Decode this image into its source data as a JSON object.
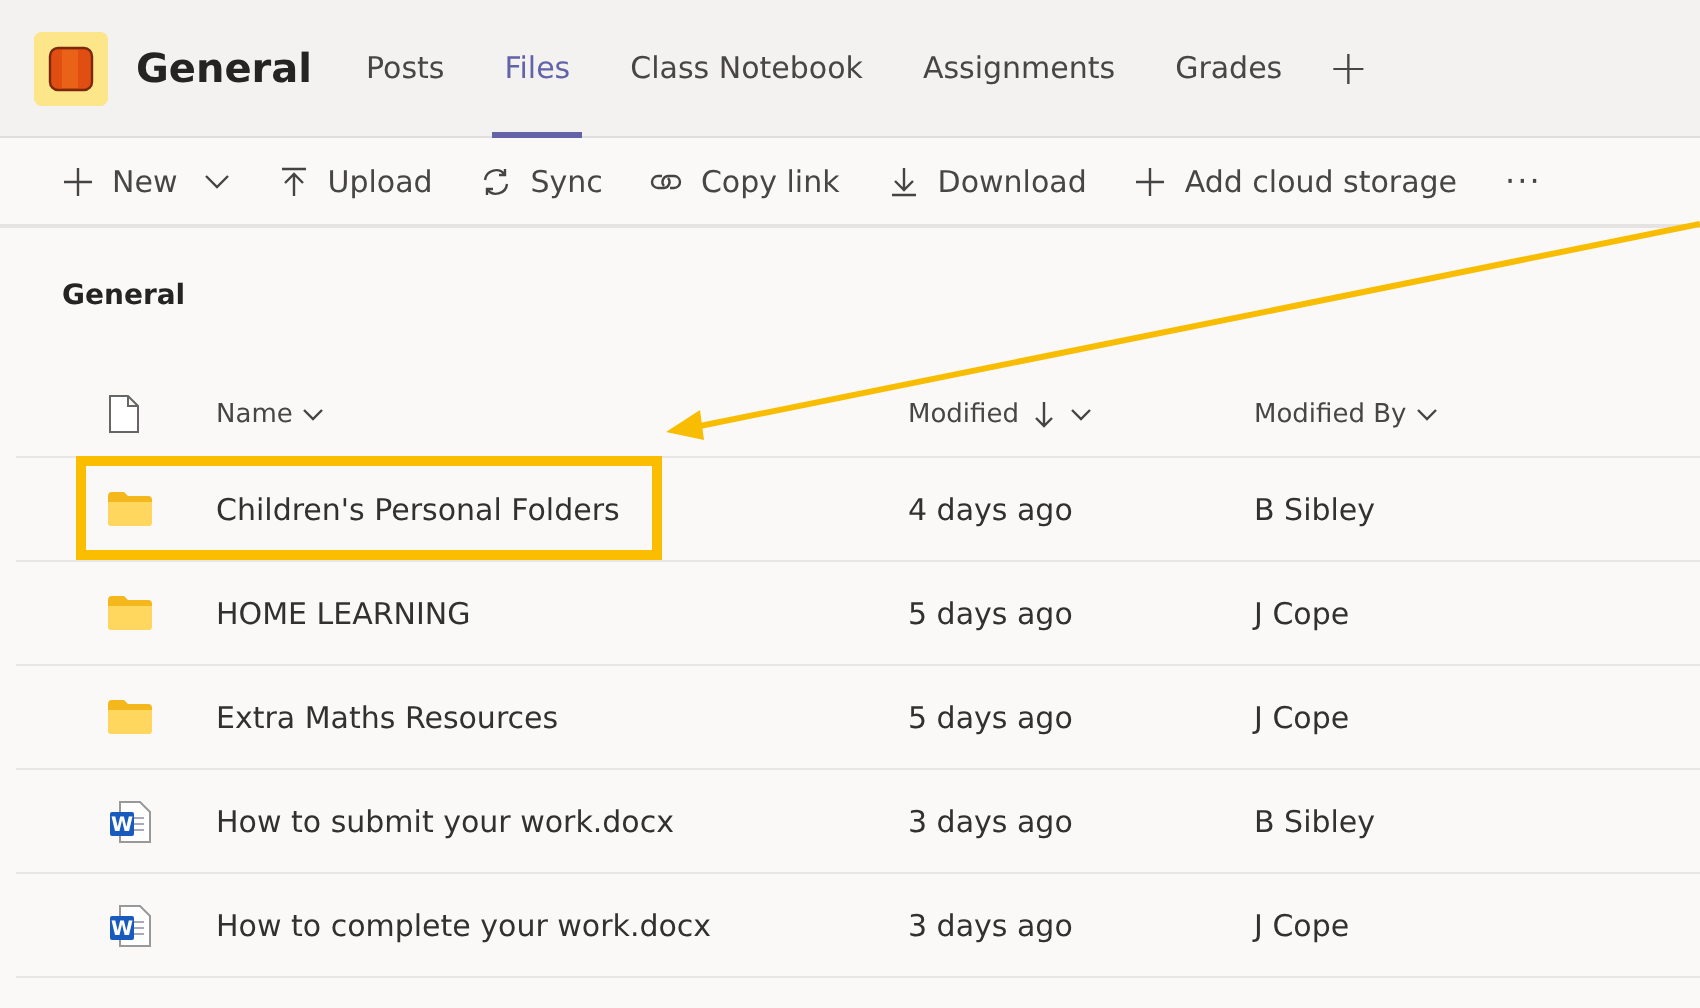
{
  "channel": {
    "name": "General"
  },
  "tabs": [
    {
      "label": "Posts",
      "selected": false
    },
    {
      "label": "Files",
      "selected": true
    },
    {
      "label": "Class Notebook",
      "selected": false
    },
    {
      "label": "Assignments",
      "selected": false
    },
    {
      "label": "Grades",
      "selected": false
    }
  ],
  "add_tab": "+",
  "toolbar": [
    {
      "kind": "plus",
      "label": "New",
      "dropdown": true
    },
    {
      "kind": "upload",
      "label": "Upload",
      "dropdown": false
    },
    {
      "kind": "sync",
      "label": "Sync",
      "dropdown": false
    },
    {
      "kind": "link",
      "label": "Copy link",
      "dropdown": false
    },
    {
      "kind": "download",
      "label": "Download",
      "dropdown": false
    },
    {
      "kind": "plus",
      "label": "Add cloud storage",
      "dropdown": false
    }
  ],
  "more": "···",
  "breadcrumb": "General",
  "columns": [
    {
      "label": "Name",
      "sorted": false
    },
    {
      "label": "Modified",
      "sorted": true
    },
    {
      "label": "Modified By",
      "sorted": false
    }
  ],
  "rows": [
    {
      "kind": "folder",
      "name": "Children's Personal Folders",
      "modified": "4 days ago",
      "modified_by": "B Sibley",
      "highlighted": true
    },
    {
      "kind": "folder",
      "name": "HOME LEARNING",
      "modified": "5 days ago",
      "modified_by": "J Cope",
      "highlighted": false
    },
    {
      "kind": "folder",
      "name": "Extra Maths Resources",
      "modified": "5 days ago",
      "modified_by": "J Cope",
      "highlighted": false
    },
    {
      "kind": "word",
      "icon_letter": "W",
      "name": "How to submit your work.docx",
      "modified": "3 days ago",
      "modified_by": "B Sibley",
      "highlighted": false
    },
    {
      "kind": "word",
      "icon_letter": "W",
      "name": "How to complete your work.docx",
      "modified": "3 days ago",
      "modified_by": "J Cope",
      "highlighted": false
    }
  ]
}
